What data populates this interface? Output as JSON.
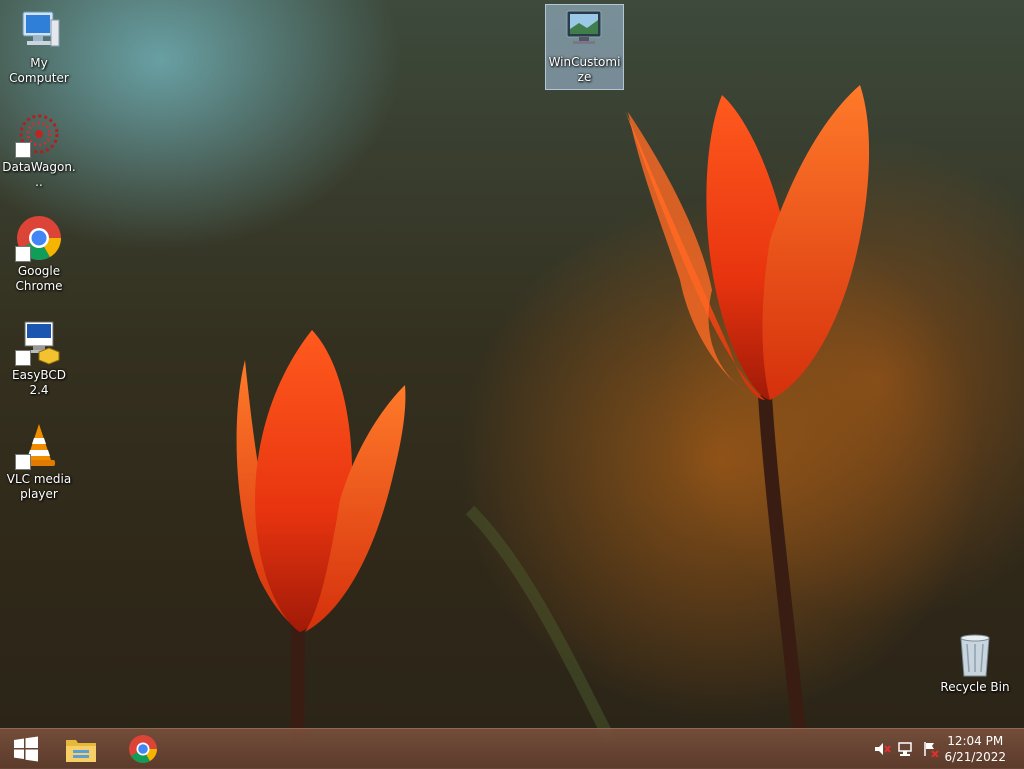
{
  "desktop": {
    "icons": [
      {
        "label": "My Computer",
        "icon": "computer-icon"
      },
      {
        "label": "DataWagon...",
        "icon": "datawagon-icon"
      },
      {
        "label": "Google Chrome",
        "icon": "chrome-icon"
      },
      {
        "label": "EasyBCD 2.4",
        "icon": "easybcd-icon"
      },
      {
        "label": "VLC media player",
        "icon": "vlc-icon"
      },
      {
        "label": "WinCustomize",
        "icon": "wincustomize-icon"
      },
      {
        "label": "Recycle Bin",
        "icon": "recycle-bin-icon"
      }
    ]
  },
  "taskbar": {
    "pinned": [
      {
        "icon": "windows-start-icon"
      },
      {
        "icon": "file-explorer-icon"
      },
      {
        "icon": "chrome-icon"
      }
    ],
    "tray": [
      {
        "icon": "volume-muted-icon"
      },
      {
        "icon": "network-icon"
      },
      {
        "icon": "action-center-flag-icon"
      }
    ],
    "clock": {
      "time": "12:04 PM",
      "date": "6/21/2022"
    }
  }
}
